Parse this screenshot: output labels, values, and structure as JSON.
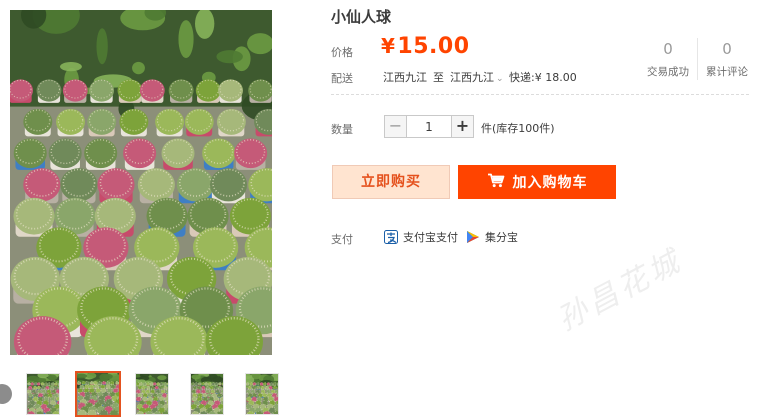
{
  "product": {
    "title": "小仙人球"
  },
  "price": {
    "label": "价格",
    "currency": "¥",
    "value": "15.00"
  },
  "shipping": {
    "label": "配送",
    "from": "江西九江",
    "to_word": "至",
    "to": "江西九江",
    "method": "快递:",
    "fee": "¥ 18.00"
  },
  "stats": [
    {
      "value": "0",
      "label": "交易成功"
    },
    {
      "value": "0",
      "label": "累计评论"
    }
  ],
  "quantity": {
    "label": "数量",
    "value": "1",
    "minus": "−",
    "plus": "+",
    "stock": "件(库存100件)"
  },
  "buttons": {
    "buy_now": "立即购买",
    "add_to_cart": "加入购物车"
  },
  "payment": {
    "label": "支付",
    "methods": [
      {
        "name": "支付宝支付",
        "icon": "alipay-icon"
      },
      {
        "name": "集分宝",
        "icon": "jifenbao-icon"
      }
    ]
  },
  "gallery": {
    "thumb_count": 5,
    "active_index": 1,
    "image": "potted cacti on display"
  },
  "watermark": "孙昌花城",
  "colors": {
    "accent": "#ff4400",
    "price": "#ff4400",
    "buy_now_bg": "#ffe4d0"
  }
}
